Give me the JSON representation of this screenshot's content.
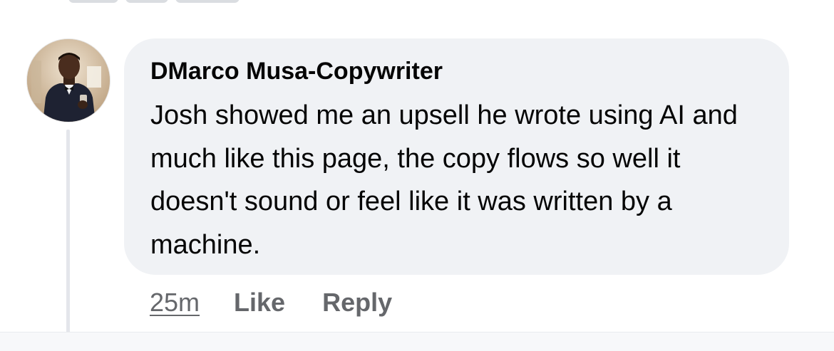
{
  "comment": {
    "author": "DMarco Musa-Copywriter",
    "text": "Josh showed me an upsell he wrote using AI and much like this page, the copy flows so well it doesn't sound or feel like it was written by a machine.",
    "timestamp": "25m",
    "like_label": "Like",
    "reply_label": "Reply"
  },
  "colors": {
    "bubble": "#f0f2f5",
    "text": "#050505",
    "secondary_text": "#65676b"
  },
  "icons": {
    "avatar": "profile-photo"
  }
}
